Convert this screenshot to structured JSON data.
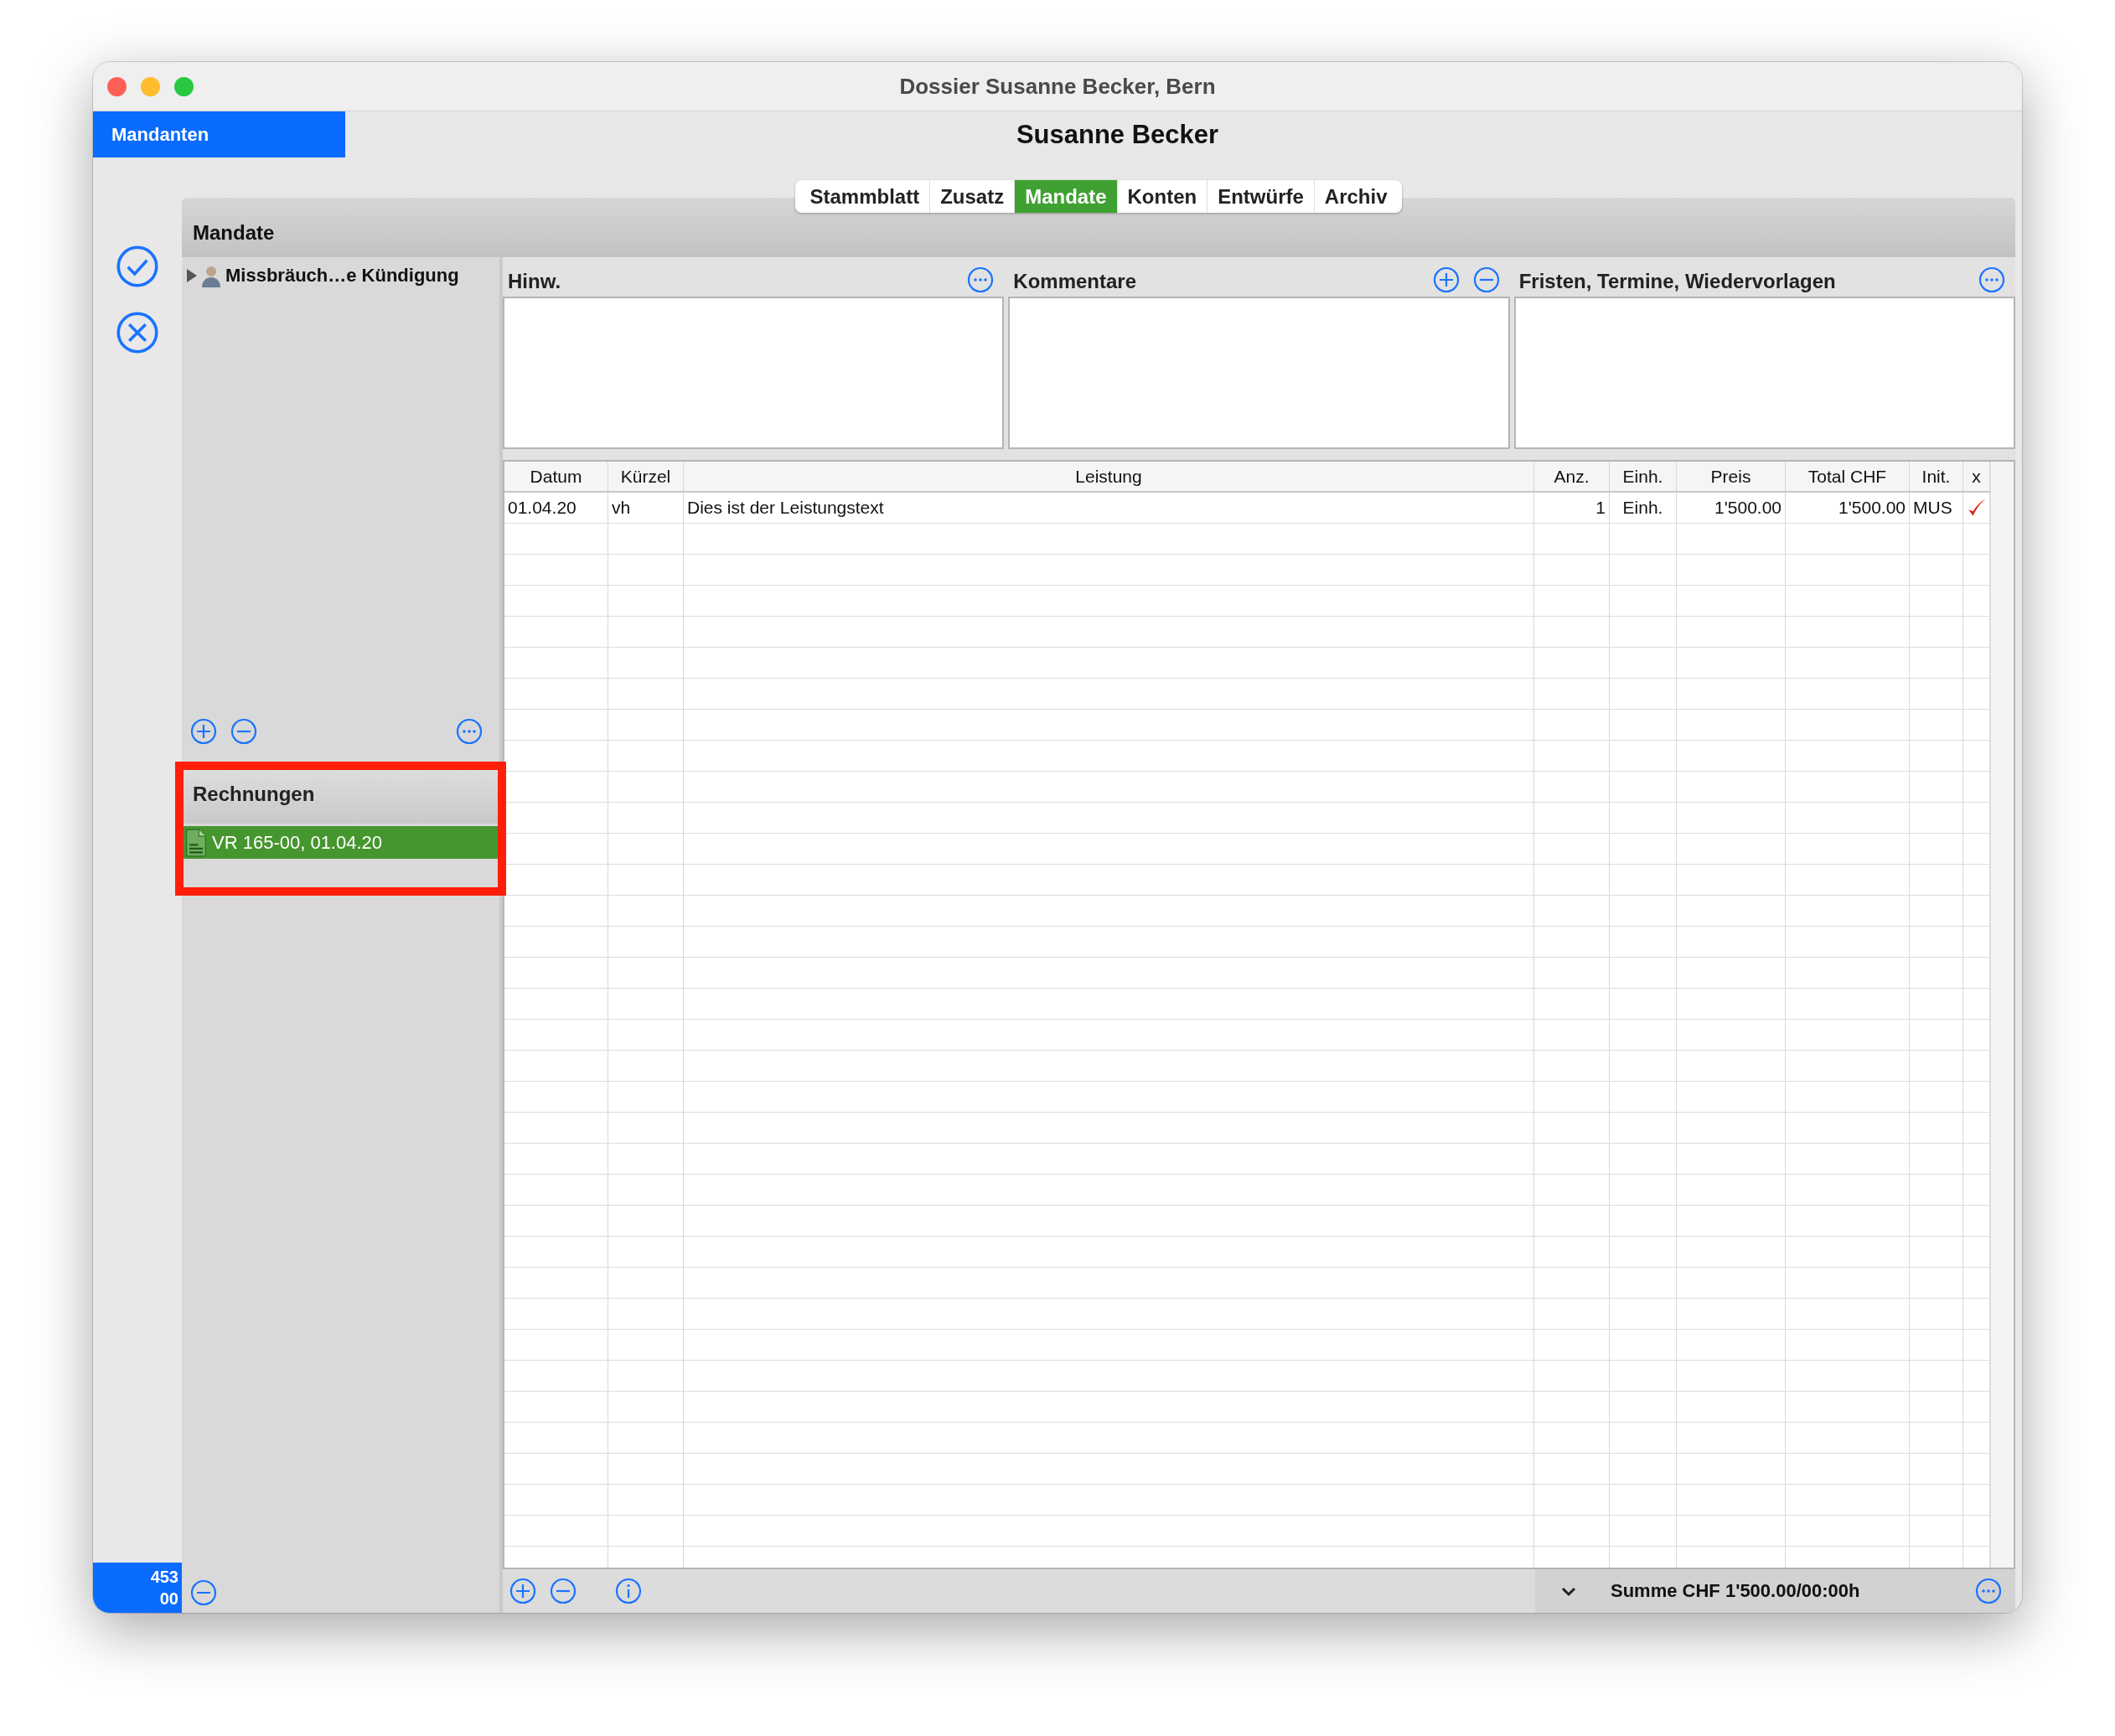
{
  "window": {
    "title": "Dossier Susanne Becker, Bern"
  },
  "sidebar_tab": {
    "label": "Mandanten",
    "selected": true
  },
  "header": {
    "name": "Susanne Becker"
  },
  "tabs": [
    {
      "label": "Stammblatt",
      "selected": false
    },
    {
      "label": "Zusatz",
      "selected": false
    },
    {
      "label": "Mandate",
      "selected": true
    },
    {
      "label": "Konten",
      "selected": false
    },
    {
      "label": "Entwürfe",
      "selected": false
    },
    {
      "label": "Archiv",
      "selected": false
    }
  ],
  "mandate_panel": {
    "title": "Mandate",
    "items": [
      {
        "label": "Missbräuch…e Kündigung",
        "expanded": false
      }
    ]
  },
  "rechnungen": {
    "title": "Rechnungen",
    "items": [
      {
        "label": "VR 165-00, 01.04.20",
        "selected": true
      }
    ]
  },
  "note_panels": [
    {
      "title": "Hinw.",
      "kind": "more"
    },
    {
      "title": "Kommentare",
      "kind": "addremove"
    },
    {
      "title": "Fristen, Termine, Wiedervorlagen",
      "kind": "more"
    }
  ],
  "table": {
    "columns": [
      "Datum",
      "Kürzel",
      "Leistung",
      "Anz.",
      "Einh.",
      "Preis",
      "Total CHF",
      "Init.",
      "x"
    ],
    "rows": [
      {
        "cells": [
          "01.04.20",
          "vh",
          "Dies ist der Leistungstext",
          "1",
          "Einh.",
          "1'500.00",
          "1'500.00",
          "MUS"
        ],
        "checked": true
      }
    ]
  },
  "footer": {
    "summary": "Summe CHF 1'500.00/00:00h"
  },
  "counter": {
    "lines": [
      "453",
      "00"
    ]
  }
}
